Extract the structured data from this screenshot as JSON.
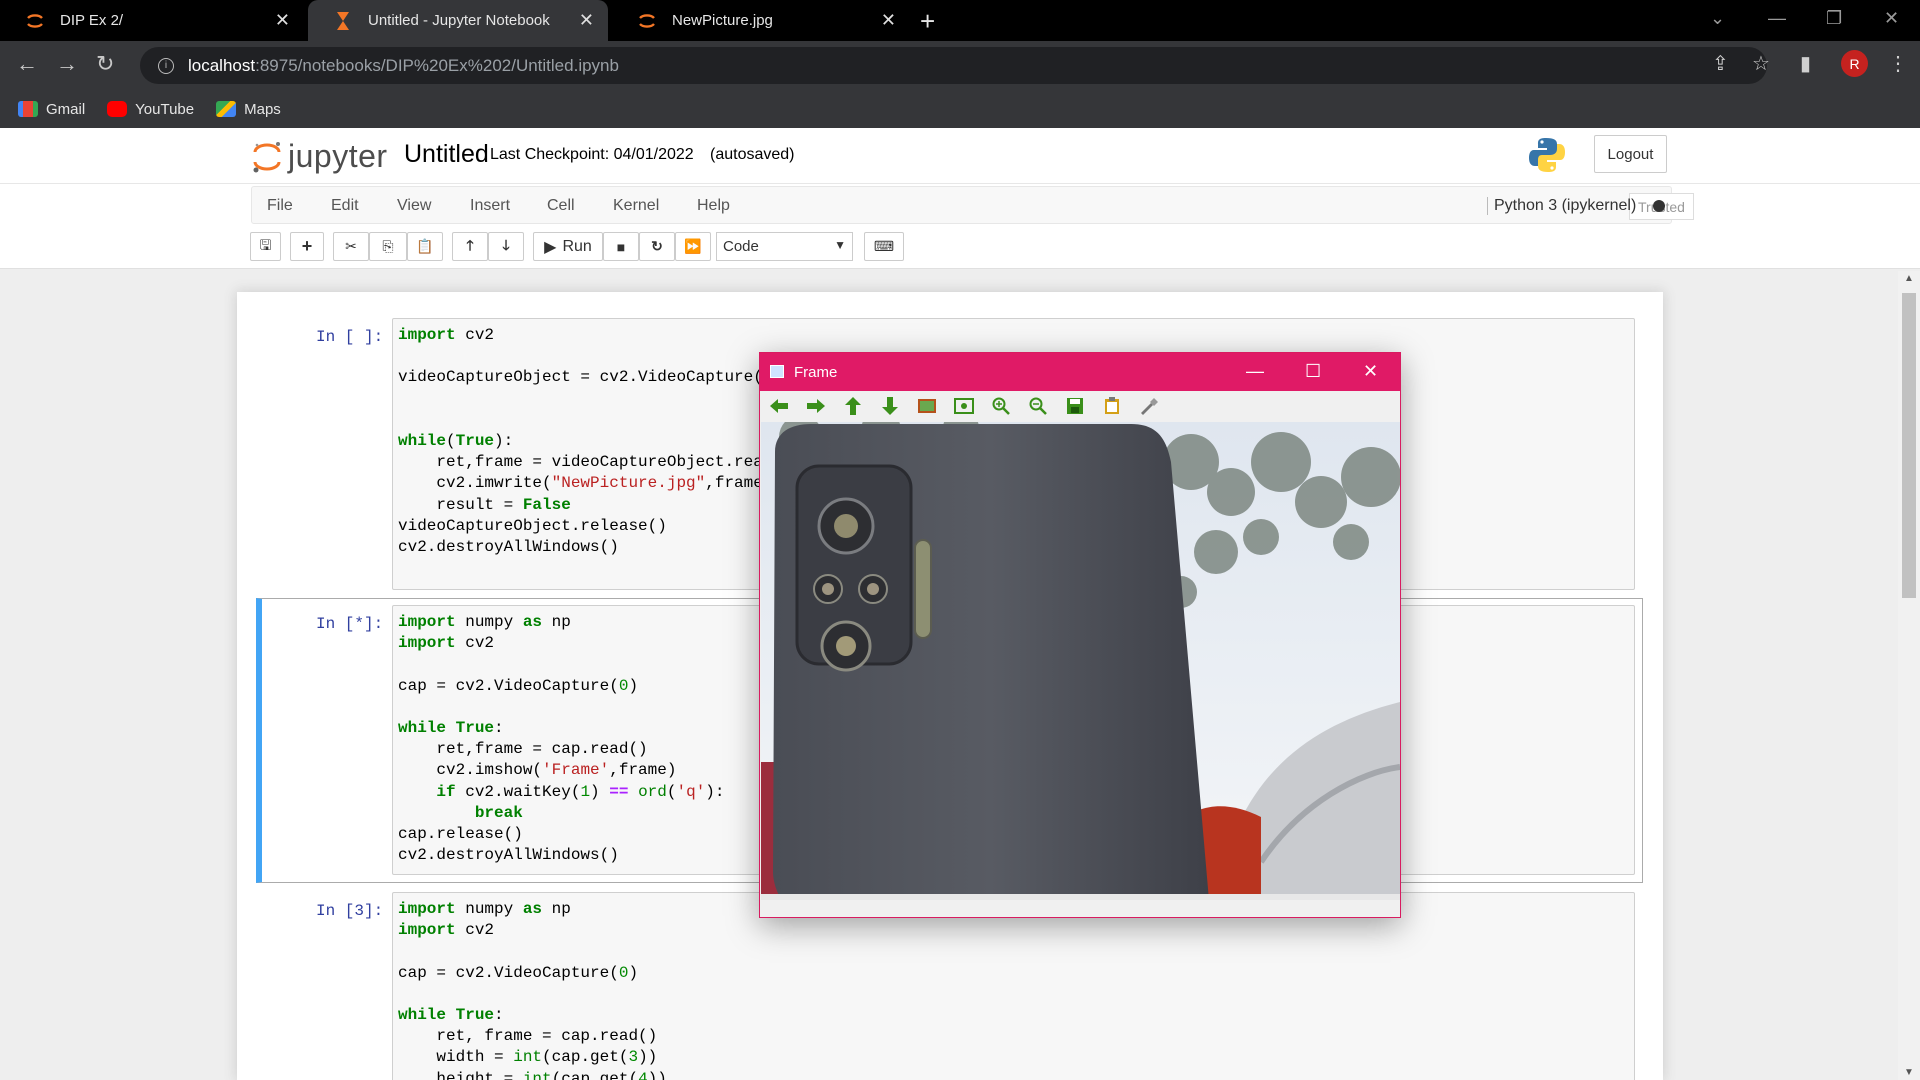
{
  "browser": {
    "tabs": [
      {
        "title": "DIP Ex 2/",
        "active": false
      },
      {
        "title": "Untitled - Jupyter Notebook",
        "active": true
      },
      {
        "title": "NewPicture.jpg",
        "active": false
      }
    ],
    "url_host": "localhost",
    "url_path": ":8975/notebooks/DIP%20Ex%202/Untitled.ipynb",
    "profile_initial": "R",
    "bookmarks": [
      {
        "label": "Gmail",
        "icon": "gmail-icon"
      },
      {
        "label": "YouTube",
        "icon": "youtube-icon"
      },
      {
        "label": "Maps",
        "icon": "maps-icon"
      }
    ]
  },
  "jupyter": {
    "logo_text": "jupyter",
    "notebook_title": "Untitled",
    "checkpoint": "Last Checkpoint: 04/01/2022",
    "autosaved": "(autosaved)",
    "logout": "Logout",
    "menu": [
      "File",
      "Edit",
      "View",
      "Insert",
      "Cell",
      "Kernel",
      "Help"
    ],
    "trusted": "Trusted",
    "kernel_name": "Python 3 (ipykernel)",
    "run_label": "Run",
    "cell_type": "Code"
  },
  "cells": [
    {
      "prompt": "In [ ]:",
      "code": [
        "import cv2",
        "",
        "videoCaptureObject = cv2.VideoCapture(",
        "",
        "",
        "while(True):",
        "    ret,frame = videoCaptureObject.rea",
        "    cv2.imwrite(\"NewPicture.jpg\",frame",
        "    result = False",
        "videoCaptureObject.release()",
        "cv2.destroyAllWindows()"
      ]
    },
    {
      "prompt": "In [*]:",
      "code": [
        "import numpy as np",
        "import cv2",
        "",
        "cap = cv2.VideoCapture(0)",
        "",
        "while True:",
        "    ret,frame = cap.read()",
        "    cv2.imshow('Frame',frame)",
        "    if cv2.waitKey(1) == ord('q'):",
        "        break",
        "cap.release()",
        "cv2.destroyAllWindows()"
      ]
    },
    {
      "prompt": "In [3]:",
      "code": [
        "import numpy as np",
        "import cv2",
        "",
        "cap = cv2.VideoCapture(0)",
        "",
        "while True:",
        "    ret, frame = cap.read()",
        "    width = int(cap.get(3))",
        "    height = int(cap.get(4))"
      ]
    }
  ],
  "frame_window": {
    "title": "Frame"
  }
}
